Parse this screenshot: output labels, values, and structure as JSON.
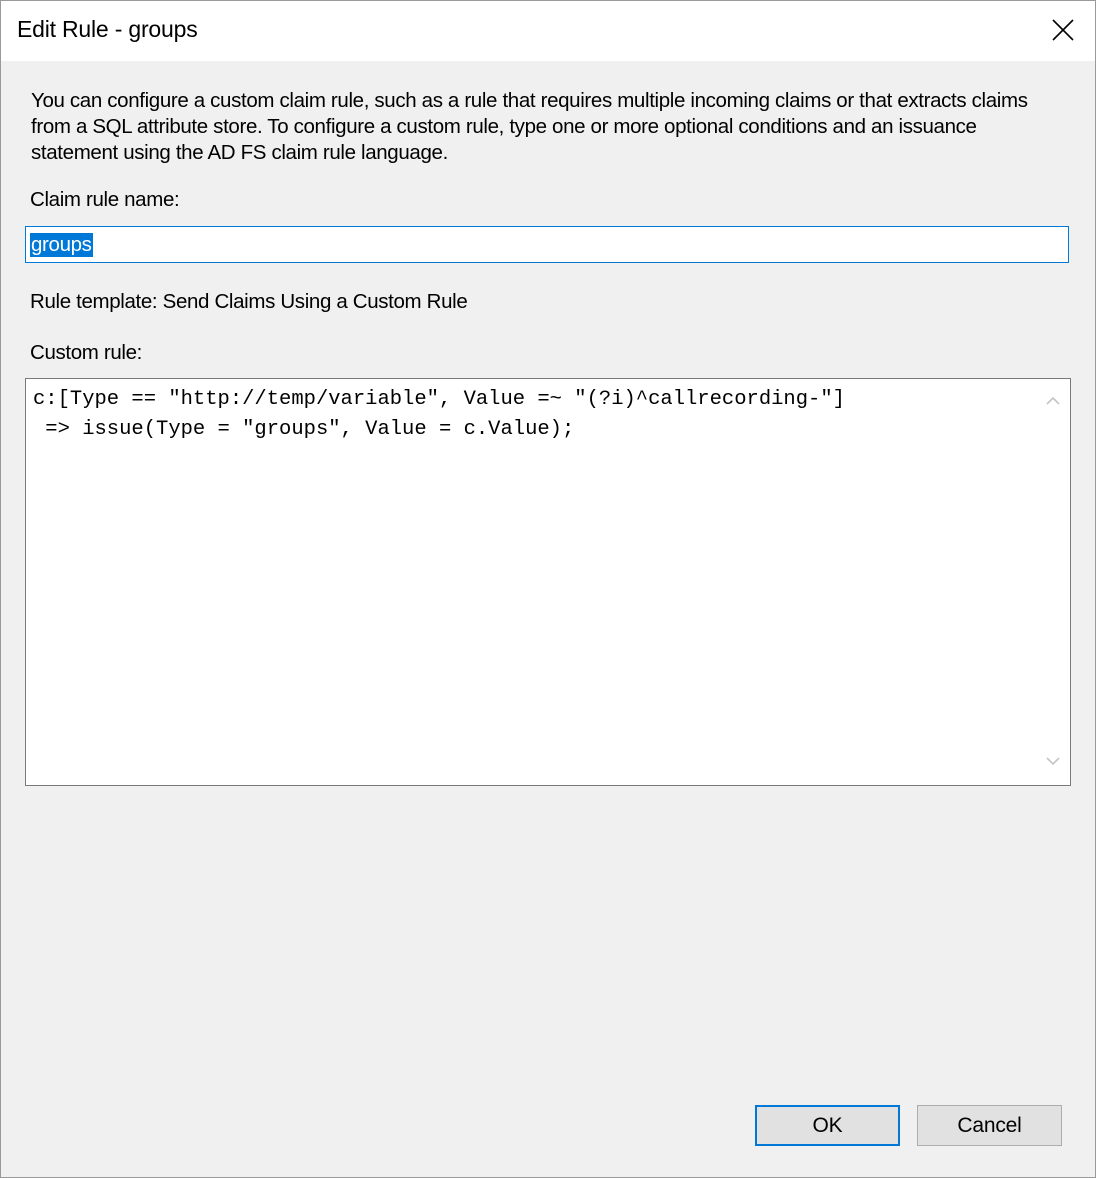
{
  "window": {
    "title": "Edit Rule - groups"
  },
  "description": "You can configure a custom claim rule, such as a rule that requires multiple incoming claims or that extracts claims from a SQL attribute store. To configure a custom rule, type one or more optional conditions and an issuance statement using the AD FS claim rule language.",
  "claim_rule_name": {
    "label": "Claim rule name:",
    "value": "groups"
  },
  "rule_template": "Rule template: Send Claims Using a Custom Rule",
  "custom_rule": {
    "label": "Custom rule:",
    "value": "c:[Type == \"http://temp/variable\", Value =~ \"(?i)^callrecording-\"]\n => issue(Type = \"groups\", Value = c.Value);"
  },
  "buttons": {
    "ok_label": "OK",
    "cancel_label": "Cancel"
  },
  "colors": {
    "accent": "#0078d7",
    "button_face": "#e1e1e1",
    "dialog_background": "#f0f0f0"
  },
  "icons": {
    "close": "close-icon",
    "scroll_up": "chevron-up-icon",
    "scroll_down": "chevron-down-icon"
  }
}
